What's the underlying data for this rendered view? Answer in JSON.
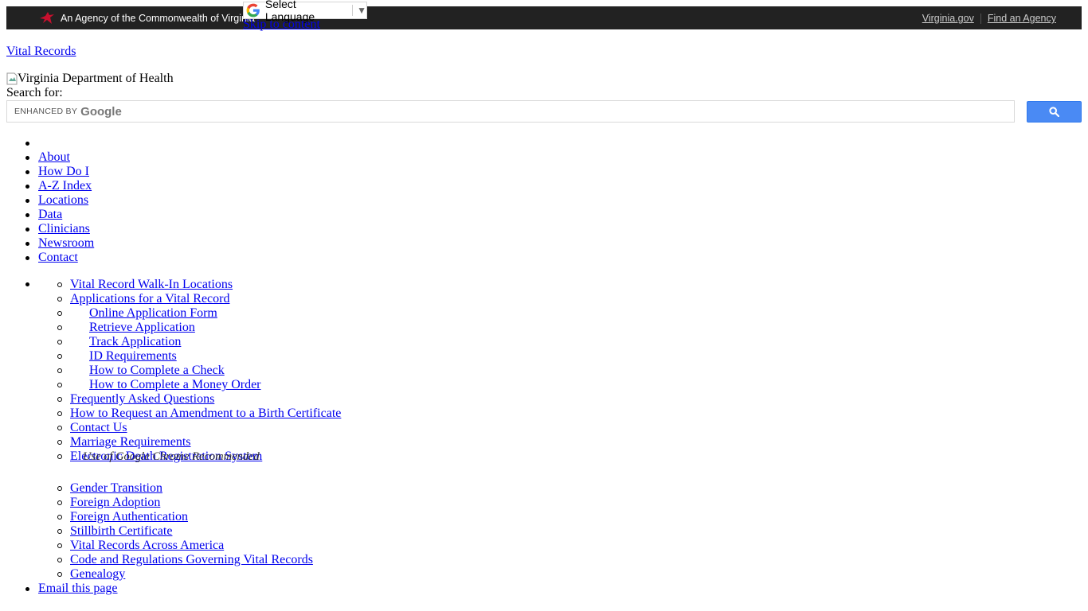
{
  "topbar": {
    "agency_text": "An Agency of the Commonwealth of Virginia",
    "links": [
      "Virginia.gov",
      "Find an Agency"
    ]
  },
  "translate": {
    "label": "Select Language",
    "arrow": "▼"
  },
  "skip_link": "Skip to content",
  "site_title": "Vital Records",
  "logo_alt": "Virginia Department of Health",
  "search": {
    "label": "Search for:",
    "enhanced_by": "ENHANCED BY",
    "google_word": "Google",
    "button_icon": "search-icon"
  },
  "nav": {
    "items": [
      "",
      "About",
      "How Do I",
      "A-Z Index",
      "Locations",
      "Data",
      "Clinicians",
      "Newsroom",
      "Contact"
    ]
  },
  "subnav": {
    "items": [
      "Vital Record Walk-In Locations",
      "Applications for a Vital Record",
      "Online Application Form",
      "Retrieve Application",
      "Track Application",
      "ID Requirements",
      "How to Complete a Check",
      "How to Complete a Money Order",
      "Frequently Asked Questions",
      "How to Request an Amendment to a Birth Certificate",
      "Contact Us",
      "Marriage Requirements",
      "Electronic Death Registration System",
      "Gender Transition",
      "Foreign Adoption",
      "Foreign Authentication",
      "Stillbirth Certificate",
      "Vital Records Across America",
      "Code and Regulations Governing Vital Records",
      "Genealogy"
    ],
    "edrs_note": "Use of Google Chrome Recommended"
  },
  "email_link": "Email this page",
  "colors": {
    "topbar_bg": "#222222",
    "link": "#0000ee",
    "search_button": "#4a8af4",
    "cardinal_red": "#c8102e"
  }
}
